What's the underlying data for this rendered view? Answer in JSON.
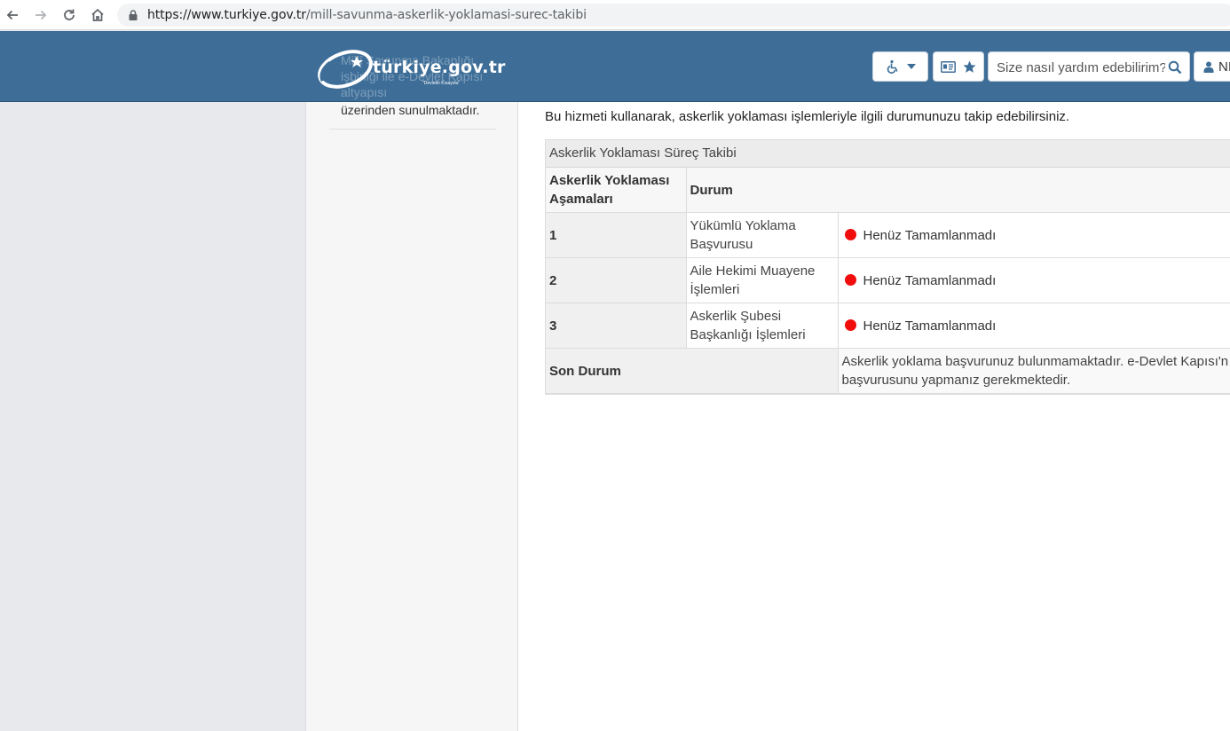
{
  "browser": {
    "url_host": "https://www.turkiye.gov.tr",
    "url_path": "/mill-savunma-askerlik-yoklamasi-surec-takibi"
  },
  "header": {
    "logo_text": "türkiye.gov.tr",
    "logo_tagline": "\"Devletin Kısayolu\"",
    "search_placeholder": "Size nasıl yardım edebilirim?",
    "user_label": "NI"
  },
  "sidebar": {
    "ghost_text": "Millî Savunma Bakanlığı işbirliği ile e-Devlet Kapısı altyapısı",
    "visible_text": "üzerinden sunulmaktadır."
  },
  "main": {
    "intro": "Bu hizmeti kullanarak, askerlik yoklaması işlemleriyle ilgili durumunuzu takip edebilirsiniz.",
    "table": {
      "caption": "Askerlik Yoklaması Süreç Takibi",
      "col_stage": "Askerlik Yoklaması Aşamaları",
      "col_status": "Durum",
      "rows": [
        {
          "num": "1",
          "step": "Yükümlü Yoklama Başvurusu",
          "status": "Henüz Tamamlanmadı"
        },
        {
          "num": "2",
          "step": "Aile Hekimi Muayene İşlemleri",
          "status": "Henüz Tamamlanmadı"
        },
        {
          "num": "3",
          "step": "Askerlik Şubesi Başkanlığı İşlemleri",
          "status": "Henüz Tamamlanmadı"
        }
      ],
      "summary_label": "Son Durum",
      "summary_text": "Askerlik yoklama başvurunuz bulunmamaktadır. e-Devlet Kapısı'n başvurusunu yapmanız gerekmektedir."
    }
  },
  "colors": {
    "header_bg": "#3e6e98",
    "status_dot": "#f20d0d",
    "icon_blue": "#3e6e98"
  }
}
